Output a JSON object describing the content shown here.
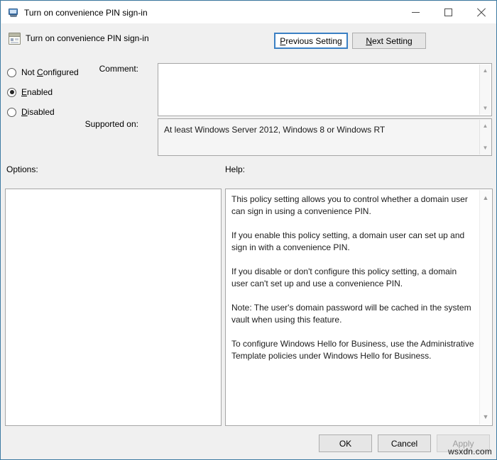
{
  "window": {
    "title": "Turn on convenience PIN sign-in",
    "title_icon": "computer-monitor-icon",
    "minimize_label": "—",
    "maximize_label": "□",
    "close_label": "✕"
  },
  "header": {
    "policy_icon": "group-policy-setting-icon",
    "policy_title": "Turn on convenience PIN sign-in",
    "previous_setting": {
      "pre": "",
      "accel": "P",
      "post": "revious Setting"
    },
    "next_setting": {
      "pre": "",
      "accel": "N",
      "post": "ext Setting"
    }
  },
  "state_options": [
    {
      "id": "not-configured",
      "pre": "Not ",
      "accel": "C",
      "post": "onfigured",
      "selected": false
    },
    {
      "id": "enabled",
      "pre": "",
      "accel": "E",
      "post": "nabled",
      "selected": true
    },
    {
      "id": "disabled",
      "pre": "",
      "accel": "D",
      "post": "isabled",
      "selected": false
    }
  ],
  "fields": {
    "comment_label": "Comment:",
    "comment_value": "",
    "supported_label": "Supported on:",
    "supported_value": "At least Windows Server 2012, Windows 8 or Windows RT"
  },
  "sections": {
    "options_label": "Options:",
    "help_label": "Help:"
  },
  "help": {
    "paragraphs": [
      "This policy setting allows you to control whether a domain user can sign in using a convenience PIN.",
      "If you enable this policy setting, a domain user can set up and sign in with a convenience PIN.",
      "If you disable or don't configure this policy setting, a domain user can't set up and use a convenience PIN.",
      "Note: The user's domain password will be cached in the system vault when using this feature.",
      "To configure Windows Hello for Business, use the Administrative Template policies under Windows Hello for Business."
    ]
  },
  "footer": {
    "ok": "OK",
    "cancel": "Cancel",
    "apply": "Apply",
    "apply_enabled": false
  },
  "watermark": "wsxdn.com",
  "scroll_glyphs": {
    "up": "▲",
    "down": "▼"
  },
  "colors": {
    "window_border": "#3e7ba3",
    "dialog_background": "#f0f0f0",
    "focus_border": "#3b80c4",
    "button_face": "#e6e6e6",
    "disabled_text": "#9d9d9d"
  }
}
